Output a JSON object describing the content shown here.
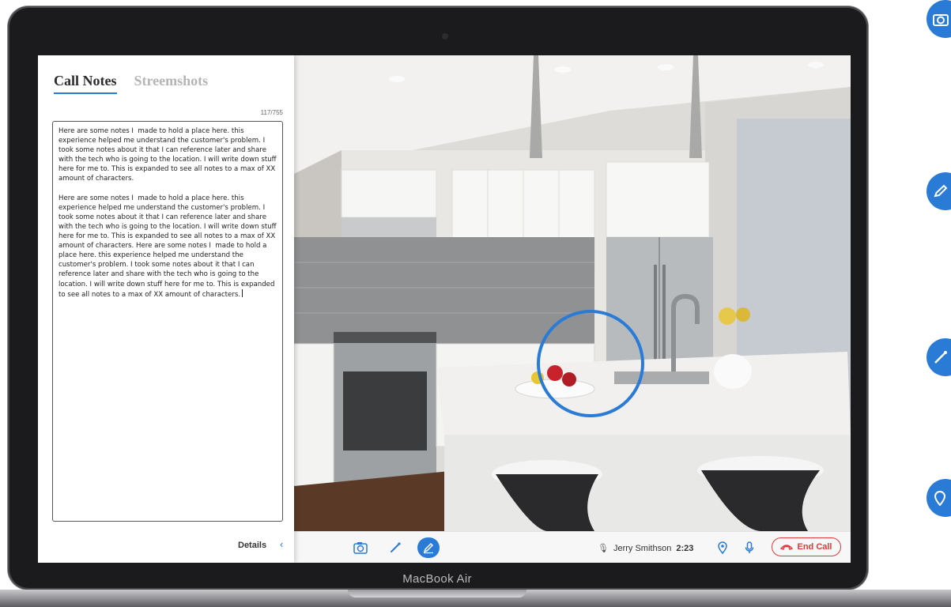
{
  "device": {
    "brand_label": "MacBook Air"
  },
  "notes_panel": {
    "tabs": [
      {
        "label": "Call Notes",
        "active": true
      },
      {
        "label": "Streemshots",
        "active": false
      }
    ],
    "char_count": "117/755",
    "notes_text": "Here are some notes I  made to hold a place here. this experience helped me understand the customer's problem. I took some notes about it that I can reference later and share with the tech who is going to the location. I will write down stuff here for me to. This is expanded to see all notes to a max of XX amount of characters.\n\nHere are some notes I  made to hold a place here. this experience helped me understand the customer's problem. I took some notes about it that I can reference later and share with the tech who is going to the location. I will write down stuff here for me to. This is expanded to see all notes to a max of XX amount of characters. Here are some notes I  made to hold a place here. this experience helped me understand the customer's problem. I took some notes about it that I can reference later and share with the tech who is going to the location. I will write down stuff here for me to. This is expanded to see all notes to a max of XX amount of characters.",
    "details_label": "Details",
    "details_icon": "chevron-left-icon"
  },
  "toolbar": {
    "tools": [
      {
        "name": "camera-icon",
        "active": false
      },
      {
        "name": "laser-pointer-icon",
        "active": false
      },
      {
        "name": "draw-pen-icon",
        "active": true
      }
    ],
    "caller_name": "Jerry Smithson",
    "call_timer": "2:23",
    "location_icon": "location-pin-icon",
    "mic_icon": "microphone-icon",
    "end_call_label": "End Call",
    "accent_color": "#2a7bd6",
    "end_call_color": "#e03a3a"
  },
  "side_actions": [
    {
      "icon": "camera-icon"
    },
    {
      "icon": "draw-pen-icon"
    },
    {
      "icon": "laser-pointer-icon"
    },
    {
      "icon": "location-pin-icon"
    }
  ]
}
